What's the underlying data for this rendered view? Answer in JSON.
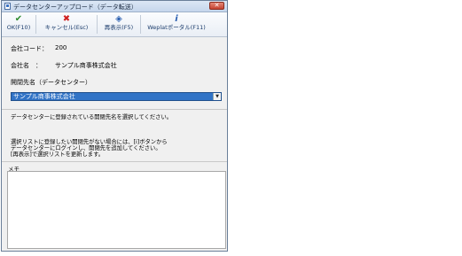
{
  "window": {
    "title": "データセンターアップロード（データ転送）",
    "close_glyph": "✕"
  },
  "toolbar": {
    "ok": {
      "label": "OK(F10)",
      "icon": "check-icon",
      "color": "#2e8b2e"
    },
    "cancel": {
      "label": "キャンセル(Esc)",
      "icon": "x-icon",
      "color": "#d02020"
    },
    "refresh": {
      "label": "再表示(F5)",
      "icon": "refresh-icon",
      "color": "#2a5fb0"
    },
    "portal": {
      "label": "Weplatポータル(F11)",
      "icon": "info-icon",
      "color": "#2a5fb0"
    }
  },
  "form": {
    "company_code_label": "会社コード：",
    "company_code_value": "200",
    "company_name_label": "会社名　：",
    "company_name_value": "サンプル商事株式会社",
    "destination_label": "開閉先名（データセンター）",
    "destination_value": "サンプル商事株式会社"
  },
  "info": {
    "line1": "データセンターに登録されている開閉先名を選択してください。",
    "line2": "選択リストに登録したい開閉先がない場合には、[i]ボタンから",
    "line3": "データセンターにログインし、開閉先を追加してください。",
    "line4": "[再表示]で選択リストを更新します。"
  },
  "memo": {
    "label": "メモ",
    "value": ""
  }
}
